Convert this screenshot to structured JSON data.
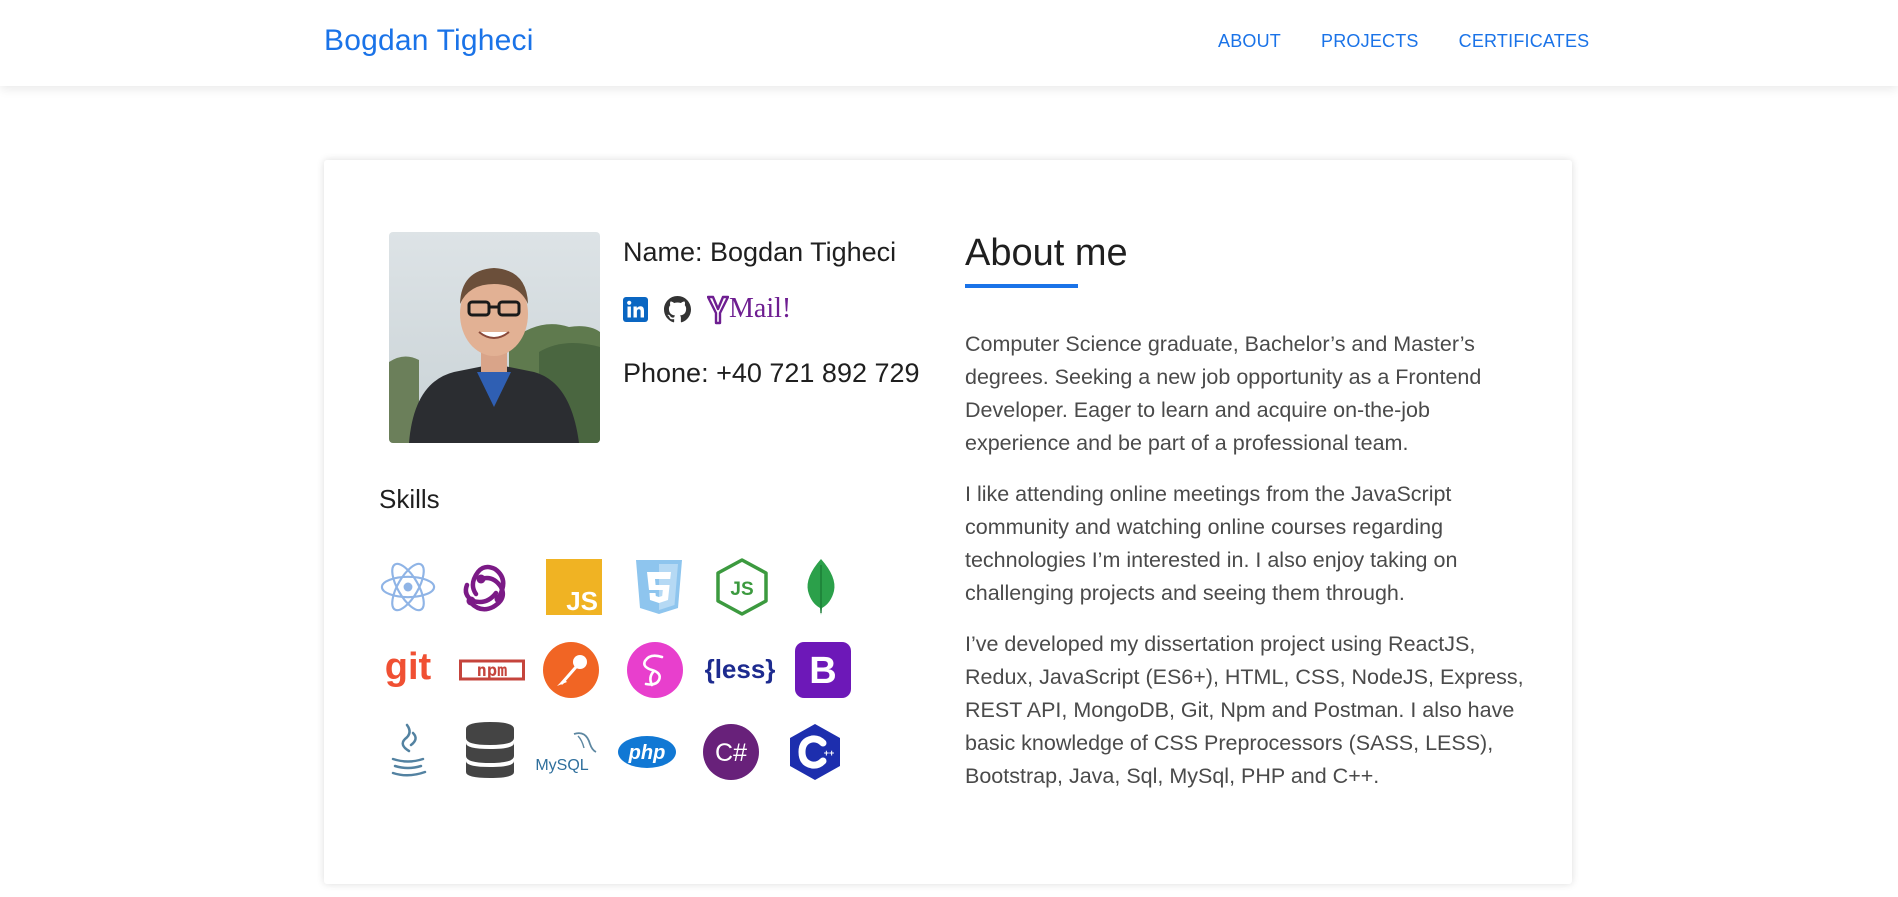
{
  "navbar": {
    "brand": "Bogdan Tigheci",
    "links": [
      "ABOUT",
      "PROJECTS",
      "CERTIFICATES"
    ]
  },
  "profile": {
    "name": "Name: Bogdan Tigheci",
    "phone": "Phone: +40 721 892 729",
    "socials": {
      "linkedin_icon": "linkedin-icon",
      "github_icon": "github-icon",
      "mail_logo": "Mail!"
    }
  },
  "skills": {
    "title": "Skills",
    "icons": [
      "react-icon",
      "redux-icon",
      "javascript-icon",
      "css3-icon",
      "nodejs-icon",
      "mongodb-icon",
      "git-icon",
      "npm-icon",
      "postman-icon",
      "sass-icon",
      "less-icon",
      "bootstrap-icon",
      "java-icon",
      "database-icon",
      "mysql-icon",
      "php-icon",
      "csharp-icon",
      "cpp-icon"
    ],
    "labels": {
      "js": "JS",
      "git": "git",
      "npm": "npm",
      "less": "{less}",
      "bootstrap": "B",
      "mysql": "MySQL",
      "php": "php",
      "csharp": "C#",
      "cpp": "C++"
    }
  },
  "about": {
    "title": "About me",
    "paragraphs": [
      "Computer Science graduate, Bachelor’s and Master’s degrees. Seeking a new job opportunity as a Frontend Developer. Eager to learn and acquire on-the-job experience and be part of a professional team.",
      "I like attending online meetings from the JavaScript community and watching online courses regarding technologies I’m interested in. I also enjoy taking on challenging projects and seeing them through.",
      "I’ve developed my dissertation project using ReactJS, Redux, JavaScript (ES6+), HTML, CSS, NodeJS, Express, REST API, MongoDB, Git, Npm and Postman. I also have basic knowledge of CSS Preprocessors (SASS, LESS), Bootstrap, Java, Sql, MySql, PHP and C++."
    ]
  },
  "colors": {
    "accent": "#1a73e8",
    "text": "#1f1f1f",
    "body_text": "#4a4a4a"
  }
}
